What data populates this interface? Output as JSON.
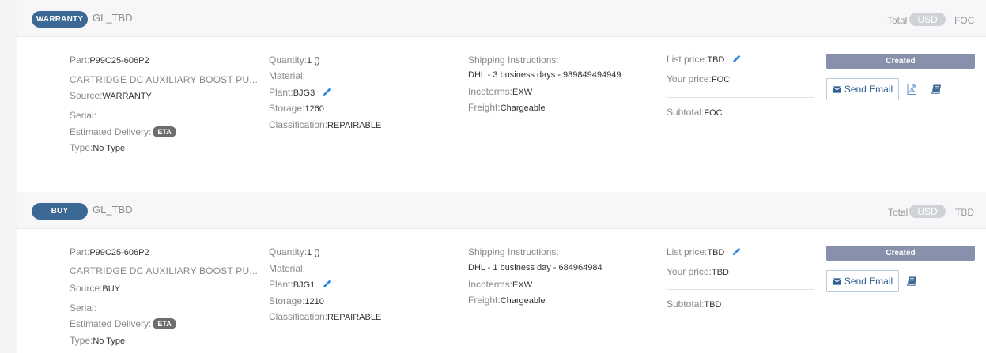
{
  "colors": {
    "badge": "#3c6896",
    "status": "#8791ab",
    "link": "#2f5e94",
    "eta": "#6d6d6d",
    "pencil": "#2a83e0"
  },
  "items": [
    {
      "type_label": "WARRANTY",
      "gl_code": "GL_TBD",
      "total_label": "Total",
      "currency": "USD",
      "total_value": "FOC",
      "part_label": "Part:",
      "part_value": "P99C25-606P2",
      "description": "CARTRIDGE DC AUXILIARY BOOST PU...",
      "source_label": "Source:",
      "source_value": "WARRANTY",
      "serial_label": "Serial:",
      "serial_value": "",
      "eta_label": "Estimated Delivery:",
      "eta_badge": "ETA",
      "type_field_label": "Type:",
      "type_field_value": "No Type",
      "quantity_label": "Quantity:",
      "quantity_value": "1 ()",
      "material_label": "Material:",
      "material_value": "",
      "plant_label": "Plant:",
      "plant_value": "BJG3",
      "storage_label": "Storage:",
      "storage_value": "1260",
      "classification_label": "Classification:",
      "classification_value": "REPAIRABLE",
      "shipping_label": "Shipping Instructions:",
      "shipping_value": "DHL - 3 business days - 989849494949",
      "incoterms_label": "Incoterms:",
      "incoterms_value": "EXW",
      "freight_label": "Freight:",
      "freight_value": "Chargeable",
      "list_price_label": "List price:",
      "list_price_value": "TBD",
      "your_price_label": "Your price:",
      "your_price_value": "FOC",
      "subtotal_label": "Subtotal:",
      "subtotal_value": "FOC",
      "status": "Created",
      "email_label": "Send Email",
      "icons": [
        "pdf-icon",
        "book-icon"
      ]
    },
    {
      "type_label": "BUY",
      "gl_code": "GL_TBD",
      "total_label": "Total",
      "currency": "USD",
      "total_value": "TBD",
      "part_label": "Part:",
      "part_value": "P99C25-606P2",
      "description": "CARTRIDGE DC AUXILIARY BOOST PU...",
      "source_label": "Source:",
      "source_value": "BUY",
      "serial_label": "Serial:",
      "serial_value": "",
      "eta_label": "Estimated Delivery:",
      "eta_badge": "ETA",
      "type_field_label": "Type:",
      "type_field_value": "No Type",
      "quantity_label": "Quantity:",
      "quantity_value": "1 ()",
      "material_label": "Material:",
      "material_value": "",
      "plant_label": "Plant:",
      "plant_value": "BJG1",
      "storage_label": "Storage:",
      "storage_value": "1210",
      "classification_label": "Classification:",
      "classification_value": "REPAIRABLE",
      "shipping_label": "Shipping Instructions:",
      "shipping_value": "DHL - 1 business day - 684964984",
      "incoterms_label": "Incoterms:",
      "incoterms_value": "EXW",
      "freight_label": "Freight:",
      "freight_value": "Chargeable",
      "list_price_label": "List price:",
      "list_price_value": "TBD",
      "your_price_label": "Your price:",
      "your_price_value": "TBD",
      "subtotal_label": "Subtotal:",
      "subtotal_value": "TBD",
      "status": "Created",
      "email_label": "Send Email",
      "icons": [
        "book-icon"
      ]
    }
  ]
}
